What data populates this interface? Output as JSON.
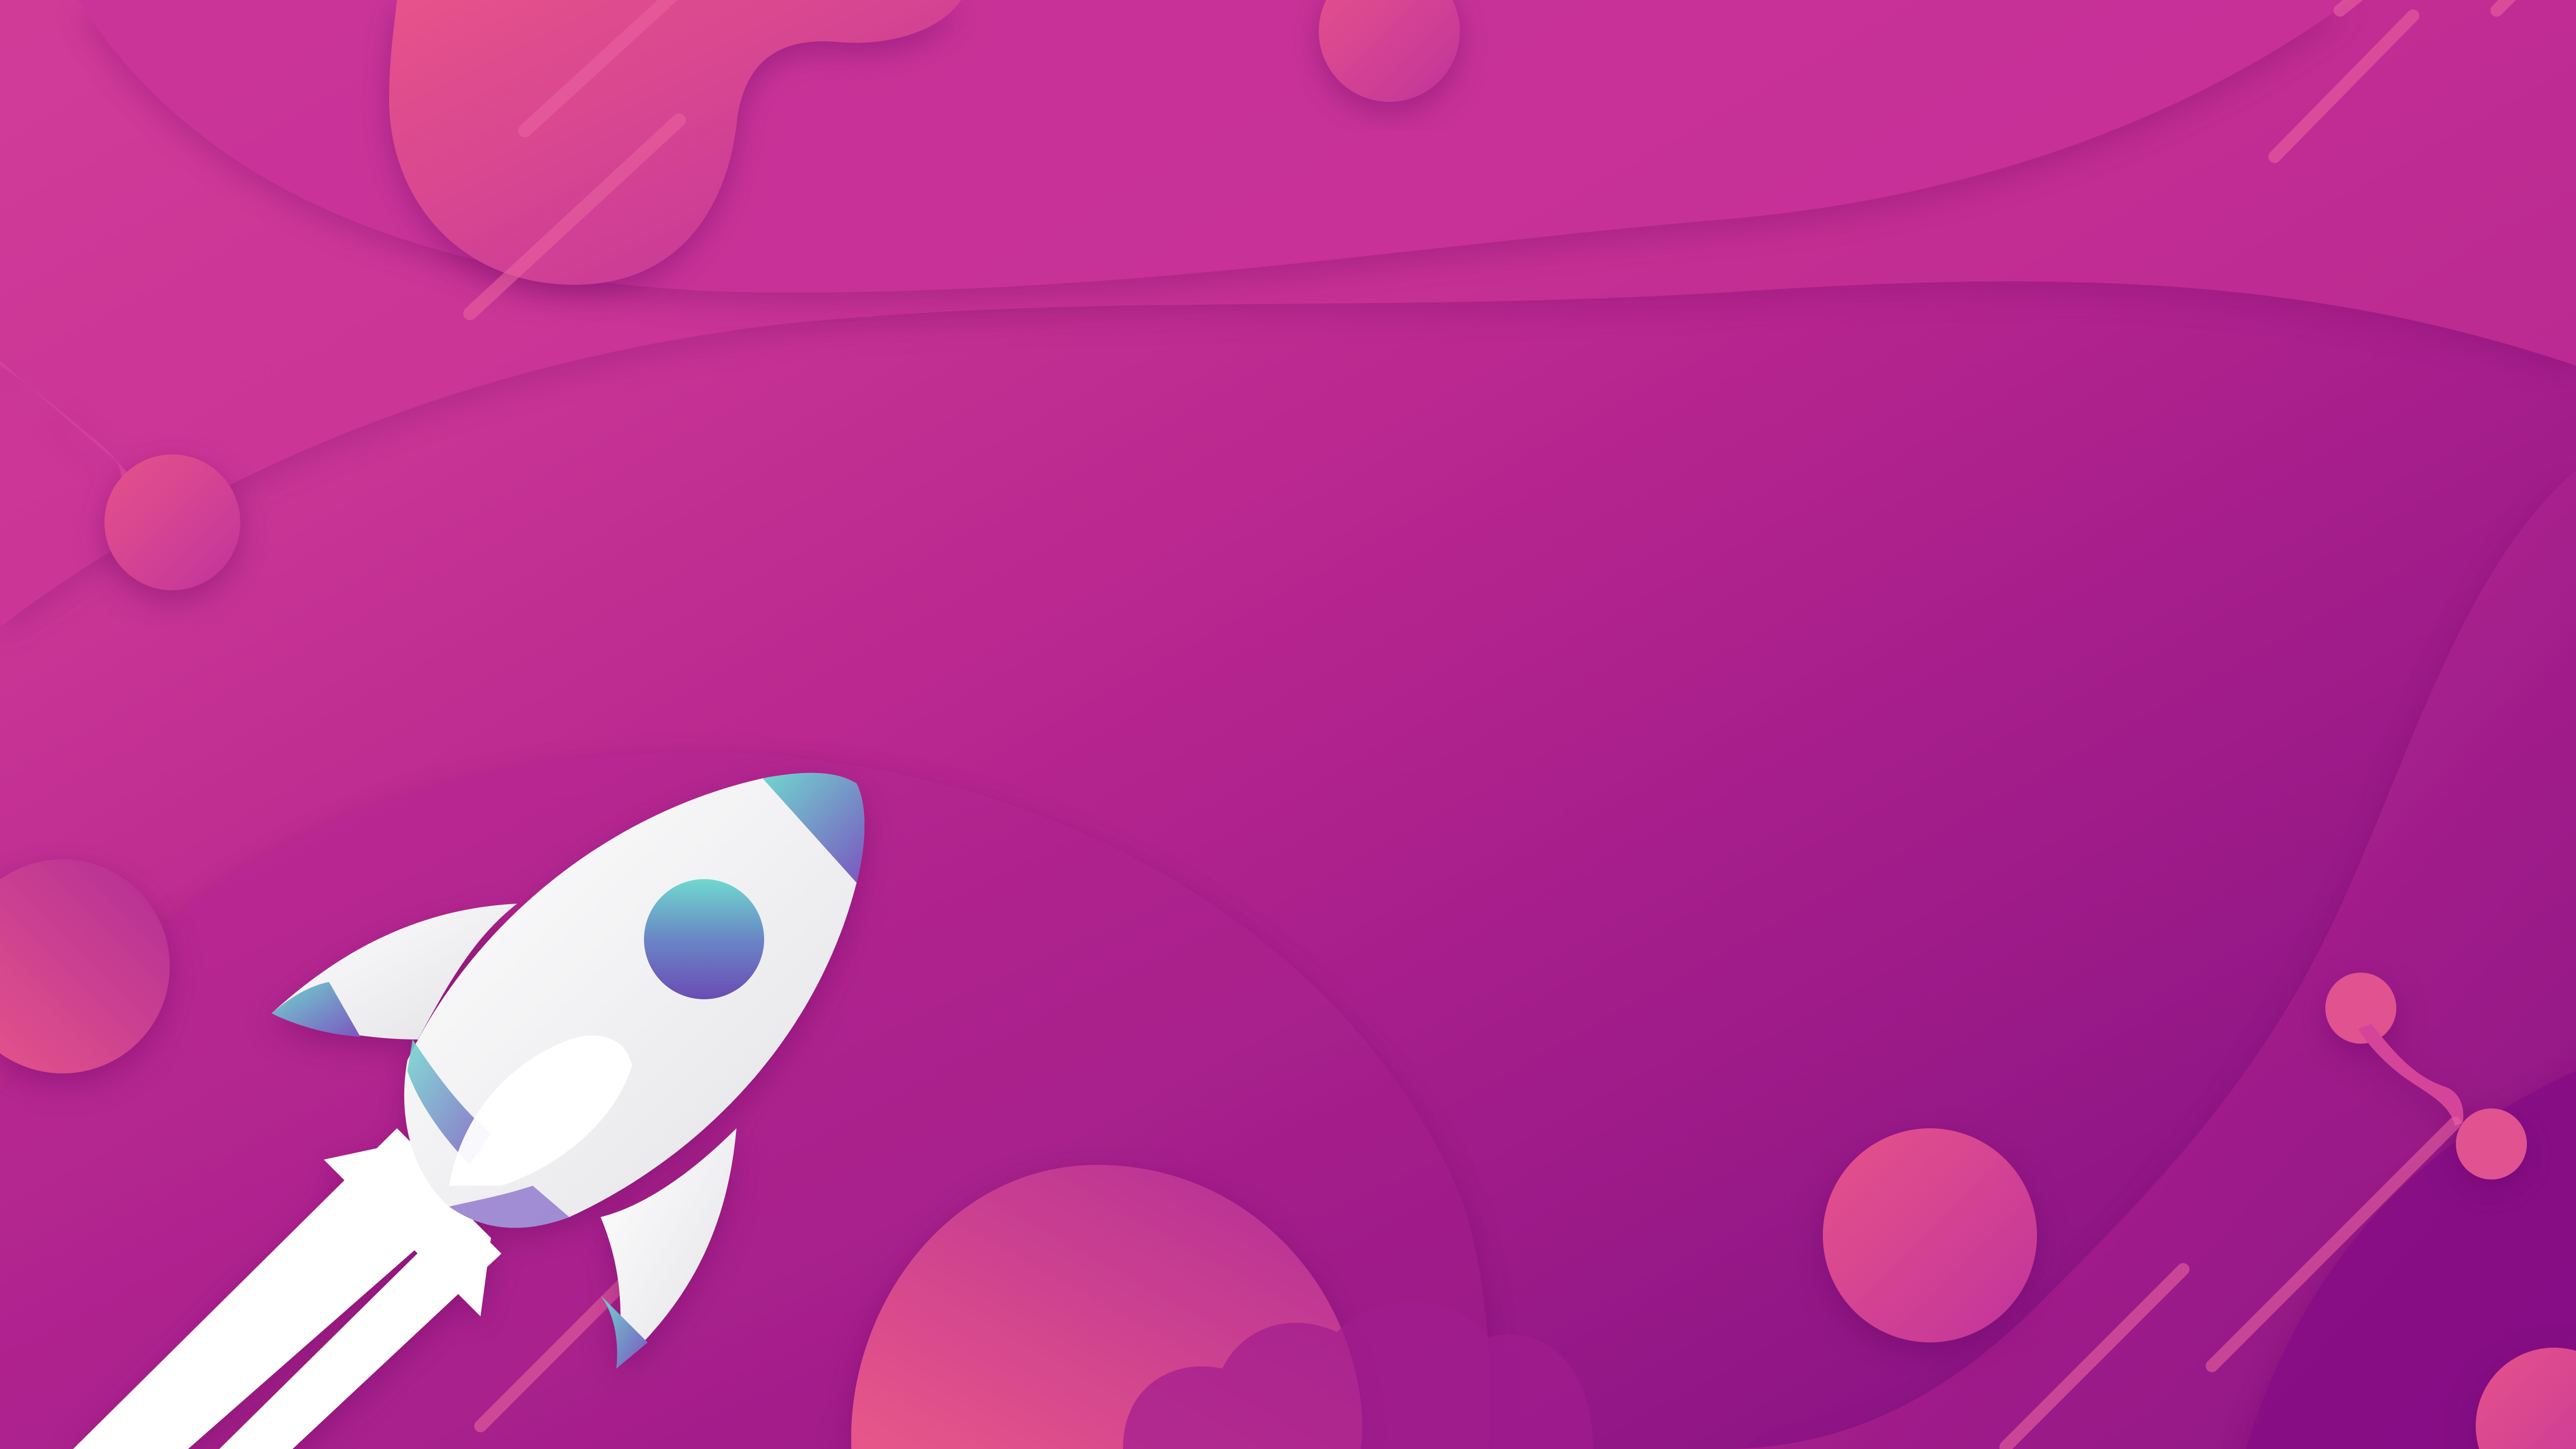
{
  "scene": {
    "colors": {
      "background_light": "#d2409a",
      "background_mid": "#b8258f",
      "background_dark": "#8a1384",
      "planet_pink": "#e8558a",
      "planet_magenta": "#c2339a",
      "rocket_body": "#ffffff",
      "rocket_shade": "#e4e4e6",
      "window_top": "#6ad6cf",
      "window_bottom": "#6a54b8",
      "trail": "#ffffff"
    },
    "icons": [
      "rocket-icon",
      "planet-icon",
      "molecule-icon",
      "shooting-star-icon"
    ]
  }
}
